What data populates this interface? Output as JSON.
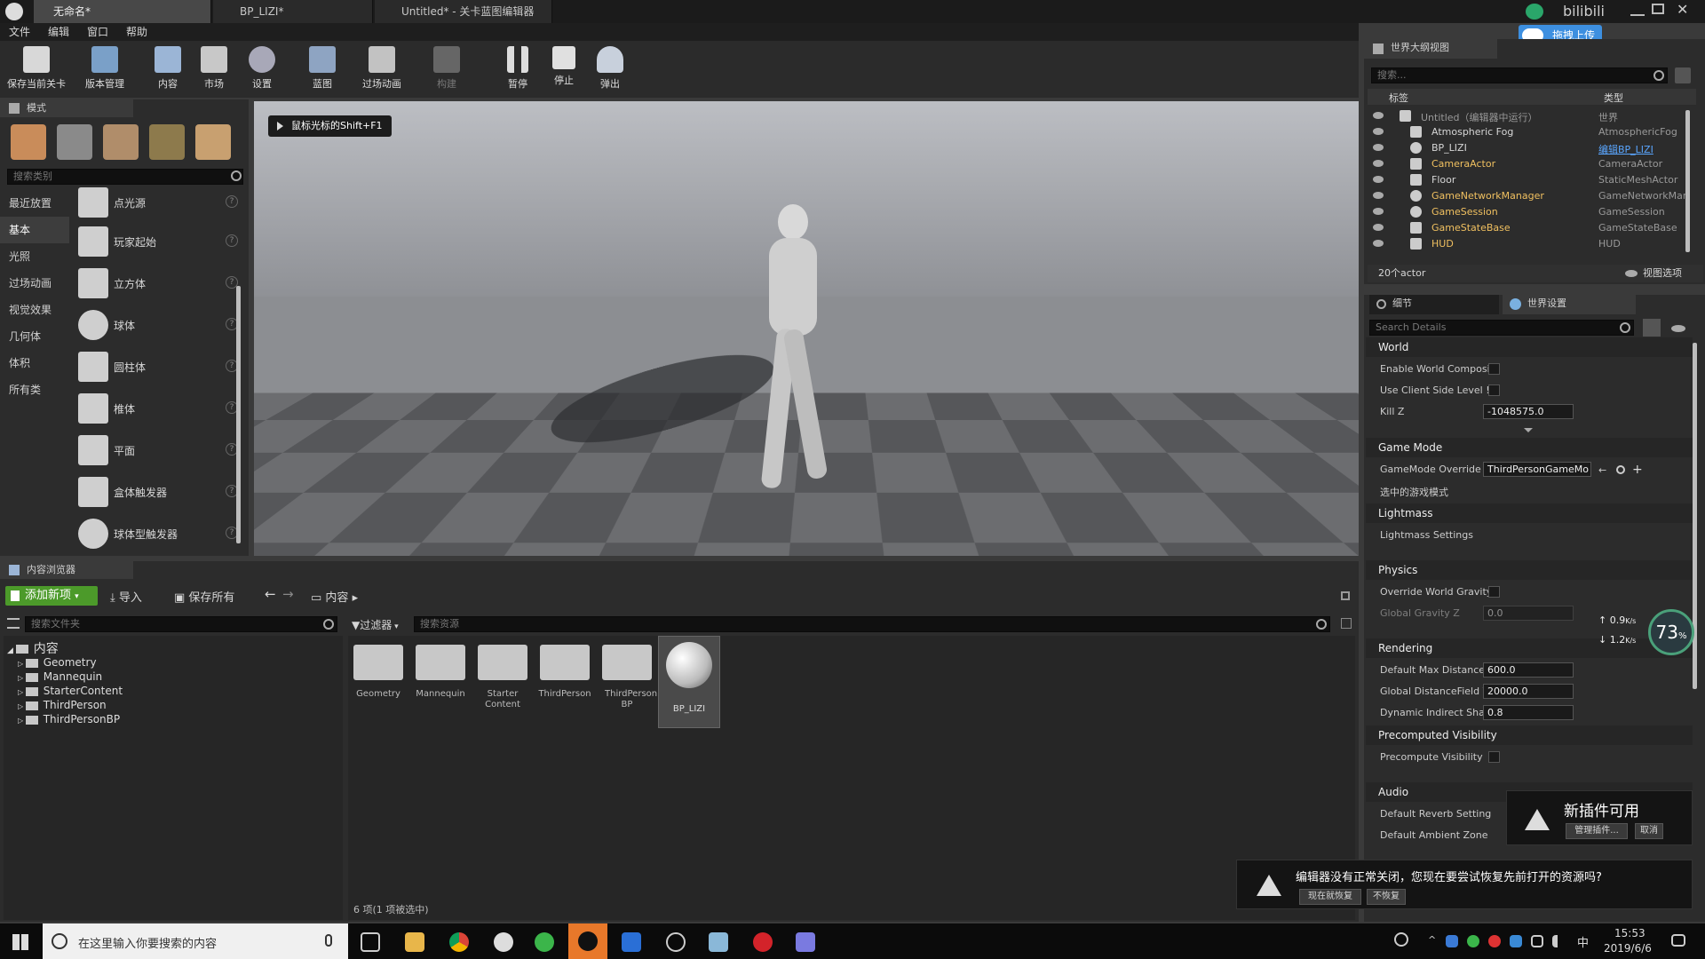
{
  "window": {
    "tabs": [
      "无命名*",
      "BP_LIZI*",
      "Untitled* - 关卡蓝图编辑器"
    ],
    "brand": "bilibili",
    "upload_button": "拖拽上传"
  },
  "menu": [
    "文件",
    "编辑",
    "窗口",
    "帮助"
  ],
  "toolbar": [
    {
      "label": "保存当前关卡",
      "icon": "save-icon"
    },
    {
      "label": "版本管理",
      "icon": "source-control-icon"
    },
    {
      "label": "内容",
      "icon": "content-icon"
    },
    {
      "label": "市场",
      "icon": "marketplace-icon"
    },
    {
      "label": "设置",
      "icon": "settings-icon"
    },
    {
      "label": "蓝图",
      "icon": "blueprint-icon"
    },
    {
      "label": "过场动画",
      "icon": "cinematics-icon"
    },
    {
      "label": "构建",
      "icon": "build-icon"
    },
    {
      "label": "暂停",
      "icon": "pause-icon"
    },
    {
      "label": "停止",
      "icon": "stop-icon"
    },
    {
      "label": "弹出",
      "icon": "eject-icon"
    }
  ],
  "modes": {
    "title": "模式",
    "search_placeholder": "搜索类别",
    "categories": [
      "最近放置",
      "基本",
      "光照",
      "过场动画",
      "视觉效果",
      "几何体",
      "体积",
      "所有类"
    ],
    "items": [
      "点光源",
      "玩家起始",
      "立方体",
      "球体",
      "圆柱体",
      "椎体",
      "平面",
      "盒体触发器",
      "球体型触发器"
    ]
  },
  "viewport": {
    "hint": "鼠标光标的Shift+F1"
  },
  "outliner": {
    "title": "世界大纲视图",
    "search_placeholder": "搜索...",
    "col_label": "标签",
    "col_type": "类型",
    "rows": [
      {
        "name": "Untitled（编辑器中运行）",
        "type": "世界"
      },
      {
        "name": "Atmospheric Fog",
        "type": "AtmosphericFog"
      },
      {
        "name": "BP_LIZI",
        "type": "编辑BP_LIZI"
      },
      {
        "name": "CameraActor",
        "type": "CameraActor"
      },
      {
        "name": "Floor",
        "type": "StaticMeshActor"
      },
      {
        "name": "GameNetworkManager",
        "type": "GameNetworkMar"
      },
      {
        "name": "GameSession",
        "type": "GameSession"
      },
      {
        "name": "GameStateBase",
        "type": "GameStateBase"
      },
      {
        "name": "HUD",
        "type": "HUD"
      }
    ],
    "count": "20个actor",
    "view_options": "视图选项"
  },
  "details": {
    "tab_details": "细节",
    "tab_world": "世界设置",
    "search_placeholder": "Search Details",
    "sections": {
      "world": "World",
      "game_mode": "Game Mode",
      "lightmass": "Lightmass",
      "physics": "Physics",
      "rendering": "Rendering",
      "precomputed": "Precomputed Visibility",
      "audio": "Audio"
    },
    "props": {
      "enable_world_comp": "Enable World Composi",
      "use_client_side": "Use Client Side Level !",
      "kill_z": "Kill Z",
      "kill_z_val": "-1048575.0",
      "gamemode_override": "GameMode Override",
      "gamemode_val": "ThirdPersonGameMo",
      "selected_gamemode": "选中的游戏模式",
      "lightmass_settings": "Lightmass Settings",
      "override_gravity": "Override World Gravity",
      "global_gravity": "Global Gravity Z",
      "global_gravity_val": "0.0",
      "default_max_dist": "Default Max Distance",
      "default_max_dist_val": "600.0",
      "global_distance": "Global DistanceField V",
      "global_distance_val": "20000.0",
      "dynamic_indirect": "Dynamic Indirect Shac",
      "dynamic_indirect_val": "0.8",
      "precompute_vis": "Precompute Visibility",
      "reverb": "Default Reverb Setting",
      "ambient": "Default Ambient Zone"
    }
  },
  "net_widget": {
    "up": "0.9",
    "down": "1.2",
    "unit": "K/s",
    "percent": "73",
    "percent_unit": "%"
  },
  "content_browser": {
    "title": "内容浏览器",
    "add_new": "添加新项",
    "import": "导入",
    "save_all": "保存所有",
    "path": "内容",
    "folder_search": "搜索文件夹",
    "filter": "过滤器",
    "asset_search": "搜索资源",
    "tree_root": "内容",
    "tree": [
      "Geometry",
      "Mannequin",
      "StarterContent",
      "ThirdPerson",
      "ThirdPersonBP"
    ],
    "assets": [
      "Geometry",
      "Mannequin",
      "Starter Content",
      "ThirdPerson",
      "ThirdPerson BP",
      "BP_LIZI"
    ],
    "status": "6 项(1 项被选中)"
  },
  "plugin_toast": {
    "title": "新插件可用",
    "manage": "管理插件...",
    "cancel": "取消"
  },
  "restore_toast": {
    "message": "编辑器没有正常关闭，您现在要尝试恢复先前打开的资源吗?",
    "restore": "现在就恢复",
    "no_restore": "不恢复"
  },
  "taskbar": {
    "search_placeholder": "在这里输入你要搜索的内容",
    "time": "15:53",
    "date": "2019/6/6",
    "ime": "中"
  }
}
